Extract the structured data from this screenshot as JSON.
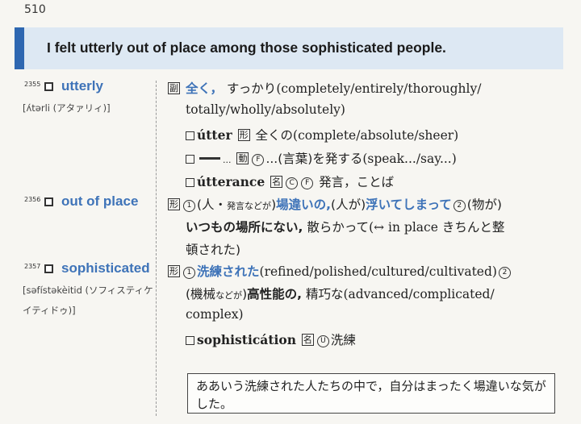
{
  "page_number": "510",
  "banner": {
    "sentence": "I felt utterly out of place among those sophisticated people."
  },
  "entries": [
    {
      "number": "2355",
      "headword": "utterly",
      "pronunciation": "[ʌ́tərli (アタァリィ)]",
      "lines": [
        {
          "pos": "副",
          "ja_def": "全く，",
          "ja_def2": "すっかり",
          "en": "(completely/entirely/thoroughly/"
        },
        {
          "en": "totally/wholly/absolutely)"
        },
        {
          "word": "útter",
          "pos": "形",
          "ja": "全くの",
          "en": "(complete/absolute/sheer)"
        },
        {
          "word_suffix": "...",
          "pos": "動",
          "circ": "F",
          "ja": "...(言葉)を発する",
          "en": "(speak.../say...)"
        },
        {
          "word": "útterance",
          "pos": "名",
          "circ1": "C",
          "circ2": "F",
          "ja": "発言，ことば"
        }
      ]
    },
    {
      "number": "2356",
      "headword": "out of place",
      "lines": [
        {
          "pos": "形",
          "circ": "1",
          "paren1": "(人・",
          "small1": "発言などが",
          "blue1": "場違いの,",
          "paren2": "(人が)",
          "blue2": "浮いてしまって",
          "circ2": "2",
          "paren3": "(物が)"
        },
        {
          "bold": "いつもの場所にない,",
          "text": "散らかって",
          "en": "(↔ in place",
          "ja": "きちんと整"
        },
        {
          "ja": "頓された)"
        }
      ]
    },
    {
      "number": "2357",
      "headword": "sophisticated",
      "pronunciation": "[səfístəkèitid (ソフィスティケ",
      "pronunciation2": "イティドゥ)]",
      "lines": [
        {
          "pos": "形",
          "circ": "1",
          "blue": "洗練された",
          "en": "(refined/polished/cultured/cultivated)",
          "circ2": "2"
        },
        {
          "paren": "(機械",
          "small": "などが",
          "paren_end": ")",
          "bold": "高性能の,",
          "ja": "精巧な",
          "en": "(advanced/complicated/"
        },
        {
          "en": "complex)"
        },
        {
          "word": "sophisticátion",
          "pos": "名",
          "circ": "U",
          "ja": "洗練"
        }
      ]
    }
  ],
  "translation": "ああいう洗練された人たちの中で，自分はまったく場違いな気がした。"
}
